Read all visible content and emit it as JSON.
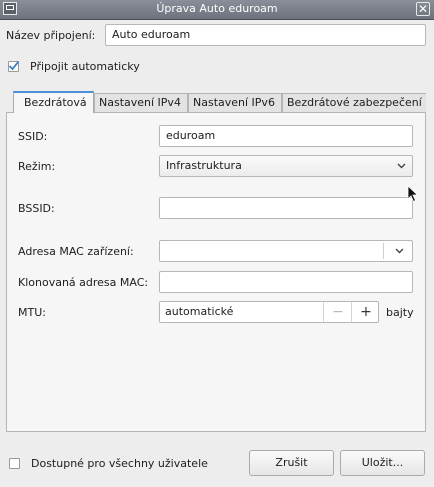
{
  "window": {
    "title": "Úprava Auto eduroam"
  },
  "connection_name": {
    "label": "Název připojení:",
    "value": "Auto eduroam"
  },
  "auto_connect": {
    "label": "Připojit automaticky",
    "checked": true
  },
  "tabs": [
    {
      "label": "Bezdrátová",
      "active": true
    },
    {
      "label": "Nastavení IPv4",
      "active": false
    },
    {
      "label": "Nastavení IPv6",
      "active": false
    },
    {
      "label": "Bezdrátové zabezpečení",
      "active": false
    }
  ],
  "wireless": {
    "ssid": {
      "label": "SSID:",
      "value": "eduroam"
    },
    "mode": {
      "label": "Režim:",
      "value": "Infrastruktura"
    },
    "bssid": {
      "label": "BSSID:",
      "value": ""
    },
    "device_mac": {
      "label": "Adresa MAC zařízení:",
      "value": ""
    },
    "cloned_mac": {
      "label": "Klonovaná adresa MAC:",
      "value": ""
    },
    "mtu": {
      "label": "MTU:",
      "value": "automatické",
      "minus": "−",
      "plus": "+",
      "unit": "bajty"
    }
  },
  "footer": {
    "all_users": {
      "label": "Dostupné pro všechny uživatele",
      "checked": false
    },
    "cancel_label": "Zrušit",
    "save_label": "Uložit..."
  },
  "colors": {
    "accent": "#4a90d9",
    "check": "#3c7fc4"
  }
}
